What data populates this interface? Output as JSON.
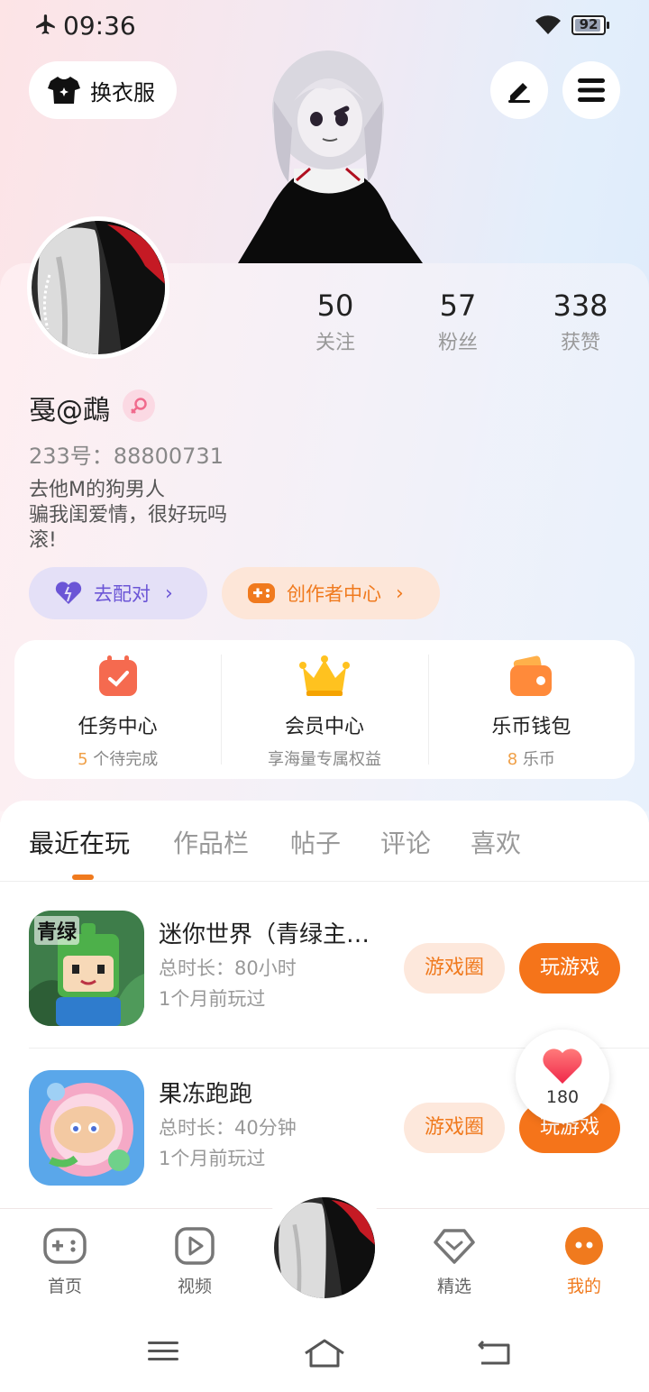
{
  "status_bar": {
    "time": "09:36",
    "battery": "92",
    "battery_level": 0.92
  },
  "top": {
    "outfit_label": "换衣服"
  },
  "profile": {
    "nickname": "戞@鵡",
    "user_id": "233号：88800731",
    "bio": [
      "去他M的狗男人",
      "骗我闺爱情，很好玩吗",
      "滚!"
    ],
    "stats": [
      {
        "num": "50",
        "label": "关注"
      },
      {
        "num": "57",
        "label": "粉丝"
      },
      {
        "num": "338",
        "label": "获赞"
      }
    ],
    "match_label": "去配对",
    "creator_label": "创作者中心"
  },
  "entries": [
    {
      "title": "任务中心",
      "sub_hl": "5",
      "sub": " 个待完成"
    },
    {
      "title": "会员中心",
      "sub_hl": "",
      "sub": "享海量专属权益"
    },
    {
      "title": "乐币钱包",
      "sub_hl": "8",
      "sub": " 乐币"
    }
  ],
  "tabs": [
    "最近在玩",
    "作品栏",
    "帖子",
    "评论",
    "喜欢"
  ],
  "games": [
    {
      "name": "迷你世界（青绿主…",
      "duration": "总时长：80小时",
      "last_played": "1个月前玩过",
      "icon_text": "青绿"
    },
    {
      "name": "果冻跑跑",
      "duration": "总时长：40分钟",
      "last_played": "1个月前玩过"
    }
  ],
  "game_actions": {
    "circle_label": "游戏圈",
    "play_label": "玩游戏"
  },
  "like_count": "180",
  "nav": [
    {
      "label": "首页"
    },
    {
      "label": "视频"
    },
    {
      "label": "精选"
    },
    {
      "label": "我的"
    }
  ],
  "colors": {
    "accent": "#f07a1e",
    "match_bg": "#e4e0f7",
    "match_fg": "#6b55d6",
    "creator_bg": "#fde6d8"
  }
}
